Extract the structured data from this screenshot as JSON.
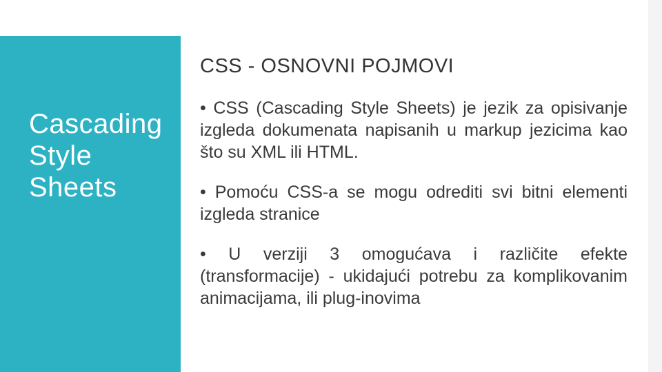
{
  "sidebar": {
    "title_line1": "Cascading",
    "title_line2": "Style Sheets"
  },
  "main": {
    "heading": "CSS - OSNOVNI POJMOVI",
    "bullets": [
      "• CSS (Cascading Style Sheets) je jezik za opisivanje izgleda dokumenata napisanih u markup jezicima kao što su XML ili HTML.",
      "• Pomoću CSS-a se mogu odrediti svi bitni elementi izgleda stranice",
      "• U verziji 3 omogućava i različite efekte (transformacije) - ukidajući potrebu za komplikovanim animacijama, ili plug-inovima"
    ]
  }
}
